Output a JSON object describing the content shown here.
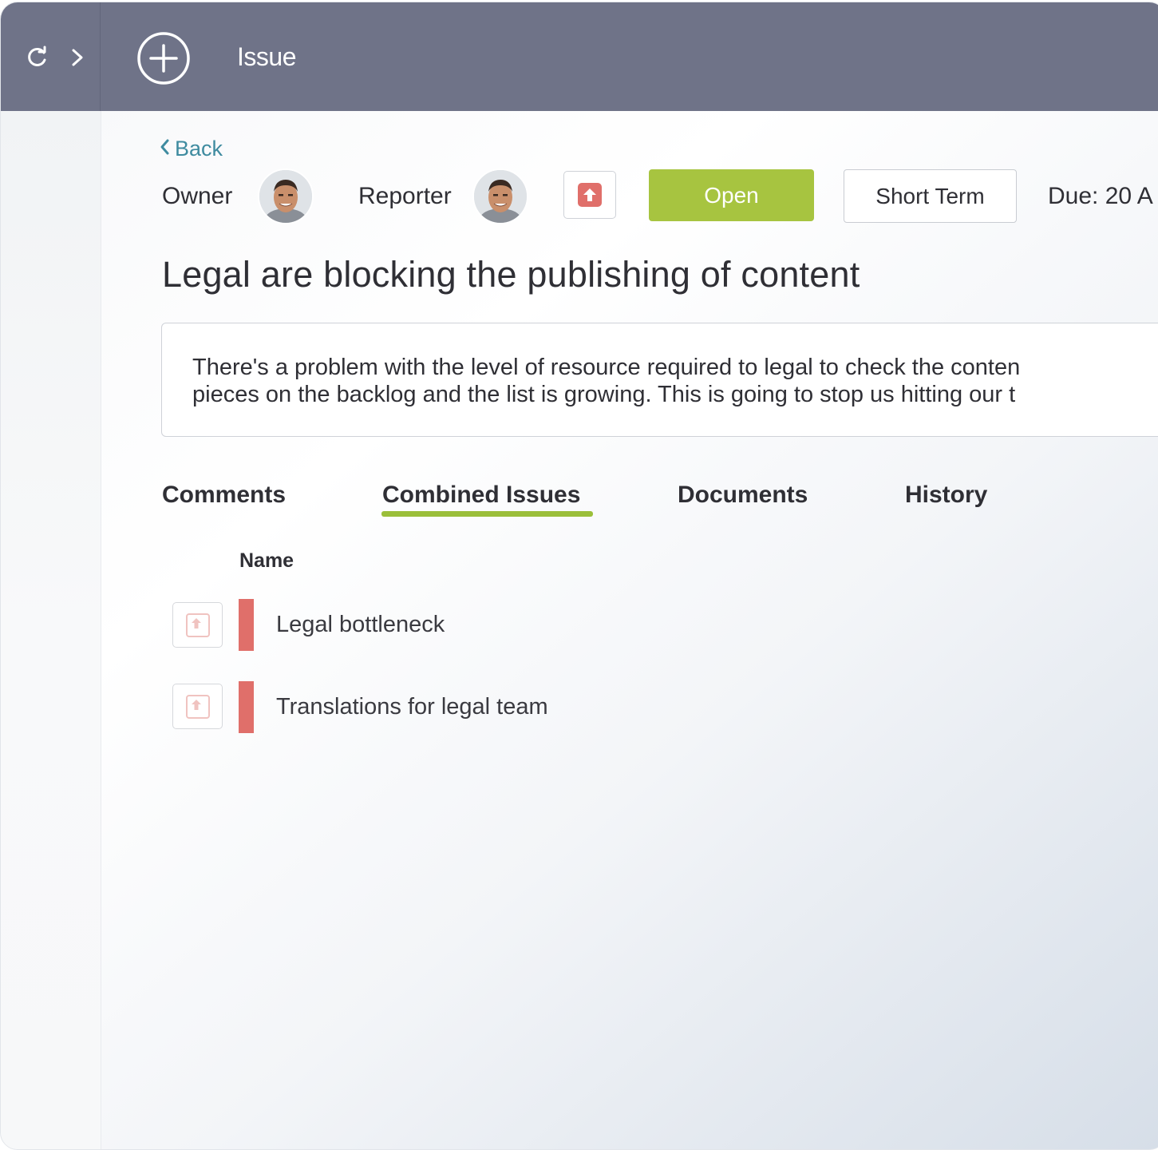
{
  "header": {
    "title": "Issue",
    "icons": [
      "refresh-icon",
      "chevron-right-icon",
      "add-circle-icon"
    ]
  },
  "nav": {
    "back_label": "Back"
  },
  "meta": {
    "owner_label": "Owner",
    "reporter_label": "Reporter",
    "status_label": "Open",
    "term_label": "Short Term",
    "due_label": "Due: 20 A"
  },
  "issue": {
    "title": "Legal are blocking the publishing of content",
    "description_line1": "There's a problem with the level of resource required to legal to check the conten",
    "description_line2": "pieces on the backlog and the list is growing. This is going to stop us hitting our t"
  },
  "tabs": [
    {
      "label": "Comments"
    },
    {
      "label": "Combined Issues"
    },
    {
      "label": "Documents"
    },
    {
      "label": "History"
    }
  ],
  "combined_issues": {
    "column_header": "Name",
    "rows": [
      {
        "name": "Legal bottleneck"
      },
      {
        "name": "Translations for legal team"
      }
    ]
  },
  "colors": {
    "topbar": "#6f7388",
    "status_green": "#a7c440",
    "priority_red": "#e06f6a",
    "link_teal": "#3f8ba0"
  }
}
